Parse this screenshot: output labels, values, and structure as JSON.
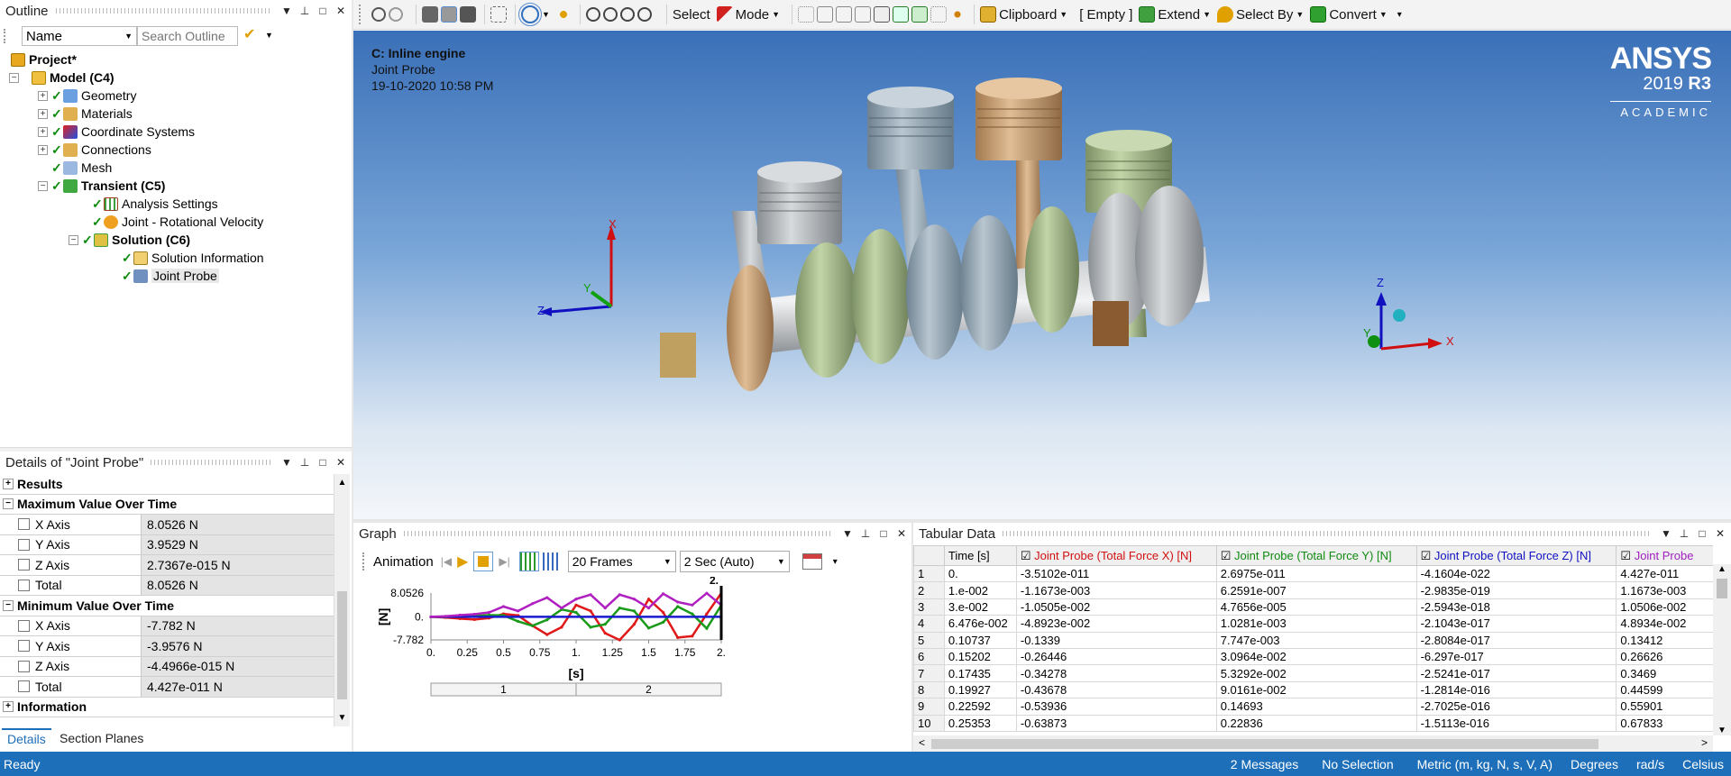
{
  "outline": {
    "title": "Outline",
    "name_select": "Name",
    "search_placeholder": "Search Outline",
    "nodes": [
      {
        "label": "Project*"
      },
      {
        "label": "Model (C4)"
      },
      {
        "label": "Geometry"
      },
      {
        "label": "Materials"
      },
      {
        "label": "Coordinate Systems"
      },
      {
        "label": "Connections"
      },
      {
        "label": "Mesh"
      },
      {
        "label": "Transient (C5)"
      },
      {
        "label": "Analysis Settings"
      },
      {
        "label": "Joint - Rotational Velocity"
      },
      {
        "label": "Solution (C6)"
      },
      {
        "label": "Solution Information"
      },
      {
        "label": "Joint Probe"
      }
    ]
  },
  "details": {
    "title": "Details of \"Joint Probe\"",
    "groups": {
      "results": "Results",
      "max": "Maximum Value Over Time",
      "min": "Minimum Value Over Time",
      "info": "Information"
    },
    "max_rows": [
      {
        "k": "X Axis",
        "v": "8.0526 N"
      },
      {
        "k": "Y Axis",
        "v": "3.9529 N"
      },
      {
        "k": "Z Axis",
        "v": "2.7367e-015 N"
      },
      {
        "k": "Total",
        "v": "8.0526 N"
      }
    ],
    "min_rows": [
      {
        "k": "X Axis",
        "v": "-7.782 N"
      },
      {
        "k": "Y Axis",
        "v": "-3.9576 N"
      },
      {
        "k": "Z Axis",
        "v": "-4.4966e-015 N"
      },
      {
        "k": "Total",
        "v": "4.427e-011 N"
      }
    ],
    "tabs": [
      "Details",
      "Section Planes"
    ]
  },
  "toolbar": {
    "select": "Select",
    "mode": "Mode",
    "clipboard": "Clipboard",
    "empty": "[ Empty ]",
    "extend": "Extend",
    "select_by": "Select By",
    "convert": "Convert"
  },
  "viewport": {
    "line1": "C: Inline engine",
    "line2": "Joint Probe",
    "line3": "19-10-2020 10:58 PM",
    "logo_main": "ANSYS",
    "logo_ver": "2019",
    "logo_r": "R3",
    "logo_sub": "ACADEMIC",
    "axes": {
      "x": "X",
      "y": "Y",
      "z": "Z"
    }
  },
  "graph": {
    "title": "Graph",
    "animation": "Animation",
    "frames": "20 Frames",
    "duration": "2 Sec (Auto)",
    "ylabel": "[N]",
    "xlabel": "[s]",
    "end_marker": "2.",
    "yticks": [
      "8.0526",
      "0.",
      "-7.782"
    ],
    "xticks": [
      "0.",
      "0.25",
      "0.5",
      "0.75",
      "1.",
      "1.25",
      "1.5",
      "1.75",
      "2."
    ],
    "seg1": "1",
    "seg2": "2"
  },
  "chart_data": {
    "type": "line",
    "xlabel": "[s]",
    "ylabel": "[N]",
    "xlim": [
      0,
      2
    ],
    "ylim": [
      -7.782,
      8.0526
    ],
    "grid": false,
    "series": [
      {
        "name": "Joint Probe (Total Force X) [N]",
        "color": "#e01818",
        "x": [
          0,
          0.1,
          0.2,
          0.3,
          0.4,
          0.5,
          0.6,
          0.7,
          0.8,
          0.9,
          1.0,
          1.1,
          1.2,
          1.3,
          1.4,
          1.5,
          1.6,
          1.7,
          1.8,
          1.9,
          2.0
        ],
        "y": [
          0,
          -0.2,
          -0.6,
          -0.9,
          -0.4,
          1.0,
          0.5,
          -3.0,
          -6.0,
          -3.5,
          4.0,
          2.0,
          -5.5,
          -7.8,
          -2.5,
          6.0,
          1.5,
          -7.0,
          -6.5,
          1.0,
          8.0
        ]
      },
      {
        "name": "Joint Probe (Total Force Y) [N]",
        "color": "#1a9a1a",
        "x": [
          0,
          0.1,
          0.2,
          0.3,
          0.4,
          0.5,
          0.6,
          0.7,
          0.8,
          0.9,
          1.0,
          1.1,
          1.2,
          1.3,
          1.4,
          1.5,
          1.6,
          1.7,
          1.8,
          1.9,
          2.0
        ],
        "y": [
          0,
          0.02,
          0.1,
          0.3,
          0.6,
          0.5,
          -1.5,
          -3.0,
          -1.0,
          2.5,
          1.5,
          -3.5,
          -2.5,
          3.0,
          2.0,
          -3.8,
          -1.8,
          3.5,
          1.0,
          -3.9,
          3.9
        ]
      },
      {
        "name": "Joint Probe (Total Force Z) [N]",
        "color": "#1a1ad0",
        "x": [
          0,
          2.0
        ],
        "y": [
          0,
          0
        ]
      },
      {
        "name": "Joint Probe",
        "color": "#b020c0",
        "x": [
          0,
          0.1,
          0.2,
          0.3,
          0.4,
          0.5,
          0.6,
          0.7,
          0.8,
          0.9,
          1.0,
          1.1,
          1.2,
          1.3,
          1.4,
          1.5,
          1.6,
          1.7,
          1.8,
          1.9,
          2.0
        ],
        "y": [
          0,
          0.2,
          0.6,
          0.9,
          1.5,
          3.5,
          2.0,
          4.5,
          6.5,
          3.0,
          6.0,
          7.5,
          3.0,
          7.5,
          6.0,
          3.0,
          7.8,
          5.0,
          4.0,
          8.0,
          4.0
        ]
      }
    ]
  },
  "tabular": {
    "title": "Tabular Data",
    "headers": [
      "Time [s]",
      "Joint Probe (Total Force X) [N]",
      "Joint Probe (Total Force Y) [N]",
      "Joint Probe (Total Force Z) [N]",
      "Joint Probe"
    ],
    "header_colors": [
      "#000000",
      "#d01010",
      "#108a10",
      "#1010c0",
      "#a020c0"
    ],
    "rows": [
      [
        "1",
        "0.",
        "-3.5102e-011",
        "2.6975e-011",
        "-4.1604e-022",
        "4.427e-011"
      ],
      [
        "2",
        "1.e-002",
        "-1.1673e-003",
        "6.2591e-007",
        "-2.9835e-019",
        "1.1673e-003"
      ],
      [
        "3",
        "3.e-002",
        "-1.0505e-002",
        "4.7656e-005",
        "-2.5943e-018",
        "1.0506e-002"
      ],
      [
        "4",
        "6.476e-002",
        "-4.8923e-002",
        "1.0281e-003",
        "-2.1043e-017",
        "4.8934e-002"
      ],
      [
        "5",
        "0.10737",
        "-0.1339",
        "7.747e-003",
        "-2.8084e-017",
        "0.13412"
      ],
      [
        "6",
        "0.15202",
        "-0.26446",
        "3.0964e-002",
        "-6.297e-017",
        "0.26626"
      ],
      [
        "7",
        "0.17435",
        "-0.34278",
        "5.3292e-002",
        "-2.5241e-017",
        "0.3469"
      ],
      [
        "8",
        "0.19927",
        "-0.43678",
        "9.0161e-002",
        "-1.2814e-016",
        "0.44599"
      ],
      [
        "9",
        "0.22592",
        "-0.53936",
        "0.14693",
        "-2.7025e-016",
        "0.55901"
      ],
      [
        "10",
        "0.25353",
        "-0.63873",
        "0.22836",
        "-1.5113e-016",
        "0.67833"
      ]
    ]
  },
  "status": {
    "ready": "Ready",
    "messages": "2 Messages",
    "selection": "No Selection",
    "units": "Metric (m, kg, N, s, V, A)",
    "degrees": "Degrees",
    "rads": "rad/s",
    "celsius": "Celsius"
  }
}
